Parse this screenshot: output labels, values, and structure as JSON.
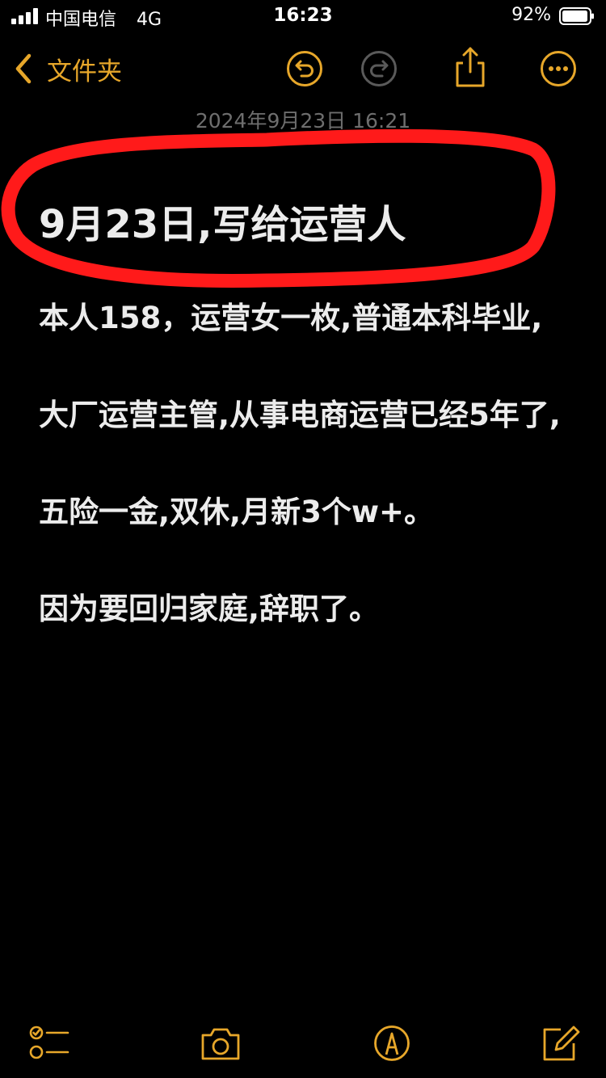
{
  "status_bar": {
    "carrier": "中国电信",
    "network": "4G",
    "time": "16:23",
    "battery": "92%"
  },
  "navbar": {
    "back_label": "文件夹",
    "icons": [
      "undo-icon",
      "redo-icon",
      "share-icon",
      "more-icon"
    ]
  },
  "note": {
    "date": "2024年9月23日 16:21",
    "title": "9月23日,写给运营人",
    "paragraphs": [
      "本人158，运营女一枚,普通本科毕业,",
      "大厂运营主管,从事电商运营已经5年了,",
      "五险一金,双休,月新3个w+。",
      "因为要回归家庭,辞职了。"
    ]
  },
  "toolbar": {
    "icons": [
      "checklist-icon",
      "camera-icon",
      "markup-pen-icon",
      "compose-icon"
    ]
  },
  "colors": {
    "accent": "#e7a72a",
    "background": "#000000",
    "text": "#ececec",
    "date": "#6e6e6e",
    "highlight_circle": "#ff1a1a"
  }
}
